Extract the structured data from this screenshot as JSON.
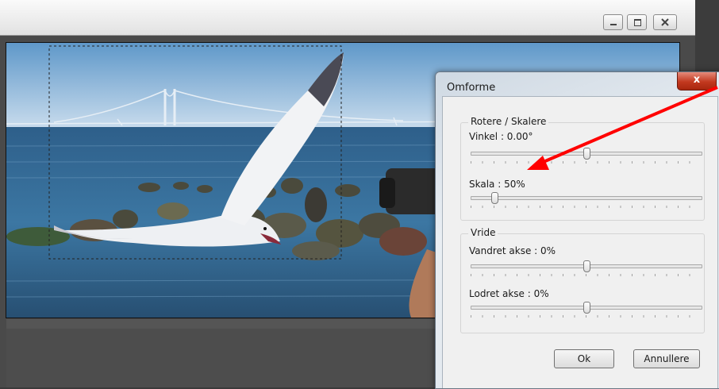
{
  "window": {
    "minimize_label": "",
    "maximize_label": "",
    "close_label": ""
  },
  "dialog": {
    "title": "Omforme",
    "close_label": "x",
    "groups": {
      "rotate_scale": {
        "label": "Rotere / Skalere",
        "angle": {
          "label": "Vinkel : 0.00°",
          "level": 0.5
        },
        "scale": {
          "label": "Skala : 50%",
          "level": 0.1
        }
      },
      "skew": {
        "label": "Vride",
        "horizontal": {
          "label": "Vandret akse : 0%",
          "level": 0.5
        },
        "vertical": {
          "label": "Lodret akse : 0%",
          "level": 0.5
        }
      }
    },
    "ok_label": "Ok",
    "cancel_label": "Annullere"
  },
  "annotation": {
    "arrow_color": "#ff0000"
  },
  "colors": {
    "sky": "#a9cbe4",
    "sea": "#3a6f96",
    "dialog_close": "#c2391f"
  }
}
